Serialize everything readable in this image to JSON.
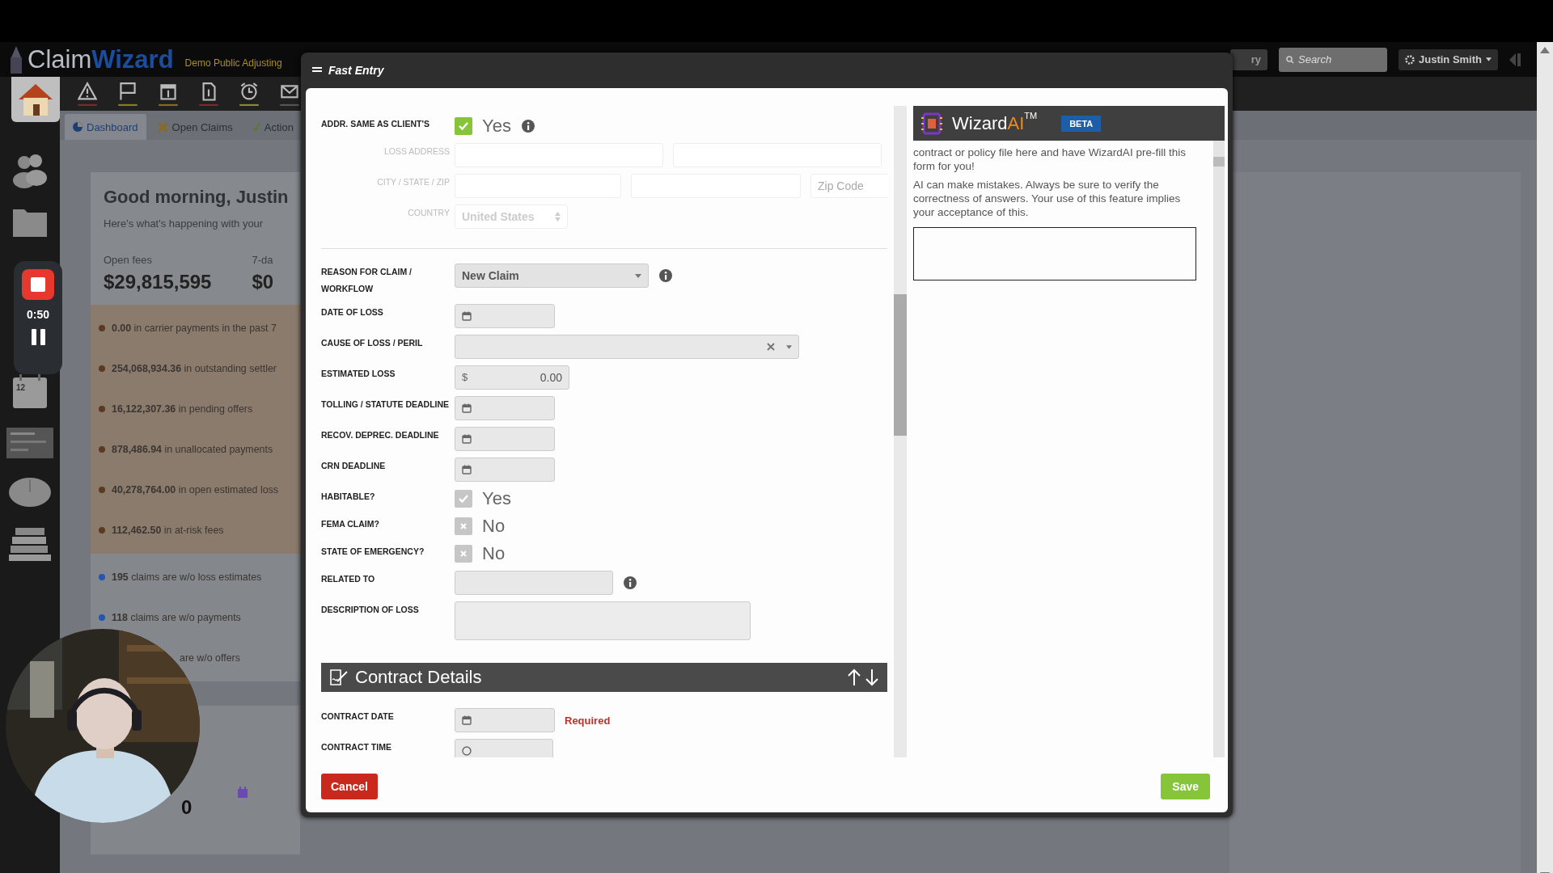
{
  "header": {
    "logo_main": "Claim",
    "logo_accent": "Wizard",
    "company": "Demo Public Adjusting",
    "history_button": "ry",
    "search": {
      "placeholder": "Search"
    },
    "user_menu": "Justin Smith"
  },
  "sidebar": {
    "calendar_day": "12"
  },
  "recorder": {
    "time": "0:50"
  },
  "tabs": [
    {
      "label": "Dashboard",
      "selected": true
    },
    {
      "label": "Open Claims",
      "selected": false
    },
    {
      "label": "Action",
      "selected": false
    }
  ],
  "dashboard": {
    "greeting": "Good morning, Justin",
    "subtitle": "Here's what's happening with your",
    "stats": [
      {
        "label": "Open fees",
        "value": "$29,815,595"
      },
      {
        "label": "7-da",
        "value": "$0"
      }
    ],
    "alerts": [
      {
        "kind": "financial",
        "amount": "0.00",
        "text": "in carrier payments in the past 7",
        "color": "#5a3a20"
      },
      {
        "kind": "financial",
        "amount": "254,068,934.36",
        "text": "in outstanding settler",
        "color": "#5a3a20"
      },
      {
        "kind": "financial",
        "amount": "16,122,307.36",
        "text": "in pending offers",
        "color": "#5a3a20"
      },
      {
        "kind": "financial",
        "amount": "878,486.94",
        "text": "in unallocated payments",
        "color": "#5a3a20"
      },
      {
        "kind": "financial",
        "amount": "40,278,764.00",
        "text": "in open estimated loss",
        "color": "#5a3a20"
      },
      {
        "kind": "financial",
        "amount": "112,462.50",
        "text": "in at-risk fees",
        "color": "#5a3a20"
      },
      {
        "kind": "claims",
        "amount": "195",
        "text": "claims are w/o loss estimates",
        "color": "#2456b0"
      },
      {
        "kind": "claims",
        "amount": "118",
        "text": "claims are w/o payments",
        "color": "#2456b0"
      },
      {
        "kind": "claims",
        "text": "are w/o offers"
      }
    ],
    "appointments": {
      "count": "0"
    }
  },
  "modal": {
    "title": "Fast Entry",
    "address_rows": [
      {
        "kind": "checkbox",
        "label": "ADDR. SAME AS CLIENT'S",
        "checked": true,
        "disabled": false,
        "value": "Yes",
        "info": true
      },
      {
        "kind": "address",
        "label": "LOSS ADDRESS"
      },
      {
        "kind": "city",
        "label": "CITY / STATE / ZIP",
        "placeholder": "Zip Code"
      },
      {
        "kind": "country",
        "label": "COUNTRY",
        "value": "United States"
      }
    ],
    "rows": [
      {
        "kind": "select",
        "label": "REASON FOR CLAIM / WORKFLOW",
        "value": "New Claim",
        "info": true
      },
      {
        "kind": "date",
        "label": "DATE OF LOSS"
      },
      {
        "kind": "combo",
        "label": "CAUSE OF LOSS / PERIL"
      },
      {
        "kind": "money",
        "label": "ESTIMATED LOSS",
        "prefix": "$",
        "value": "0.00"
      },
      {
        "kind": "date",
        "label": "TOLLING / STATUTE DEADLINE"
      },
      {
        "kind": "date",
        "label": "RECOV. DEPREC. DEADLINE"
      },
      {
        "kind": "date",
        "label": "CRN DEADLINE"
      },
      {
        "kind": "checkbox",
        "label": "HABITABLE?",
        "checked": true,
        "disabled": true,
        "value": "Yes"
      },
      {
        "kind": "checkbox",
        "label": "FEMA CLAIM?",
        "checked": false,
        "disabled": true,
        "value": "No"
      },
      {
        "kind": "checkbox",
        "label": "STATE OF EMERGENCY?",
        "checked": false,
        "disabled": true,
        "value": "No"
      },
      {
        "kind": "text",
        "label": "RELATED TO",
        "info": true
      },
      {
        "kind": "textarea",
        "label": "DESCRIPTION OF LOSS"
      }
    ],
    "section": {
      "title": "Contract Details"
    },
    "contract_rows": [
      {
        "kind": "date",
        "label": "CONTRACT DATE",
        "error": "Required"
      },
      {
        "kind": "time",
        "label": "CONTRACT TIME"
      }
    ],
    "wizard_ai": {
      "name": "Wizard",
      "accent": "AI",
      "trademark": "TM",
      "badge": "BETA",
      "paragraphs": [
        "contract or policy file here and have WizardAI pre-fill this form for you!",
        "AI can make mistakes. Always be sure to verify the correctness of answers. Your use of this feature implies your acceptance of this."
      ]
    },
    "buttons": {
      "cancel": "Cancel",
      "save": "Save"
    }
  }
}
